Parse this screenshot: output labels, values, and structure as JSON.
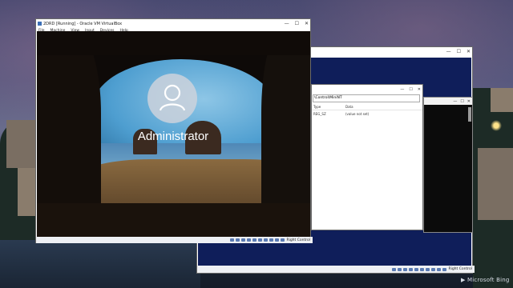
{
  "desktop": {
    "brand": "Microsoft Bing"
  },
  "vm1": {
    "title": "2DRD [Running] - Oracle VM VirtualBox",
    "menu": [
      "File",
      "Machine",
      "View",
      "Input",
      "Devices",
      "Help"
    ],
    "username": "Administrator",
    "host_key": "Right Control",
    "controls": {
      "minimize": "—",
      "maximize": "☐",
      "close": "✕"
    }
  },
  "vm2": {
    "host_key": "Right Control",
    "controls": {
      "minimize": "—",
      "maximize": "☐",
      "close": "✕"
    }
  },
  "regedit": {
    "path": "\\Control\\MiniNT",
    "columns": [
      "Type",
      "Data"
    ],
    "rows": [
      {
        "type": "REG_SZ",
        "data": "(value not set)"
      }
    ]
  },
  "colors": {
    "vm_inner_blue": "#0f1e5a",
    "accent": "#5b7bb3"
  }
}
